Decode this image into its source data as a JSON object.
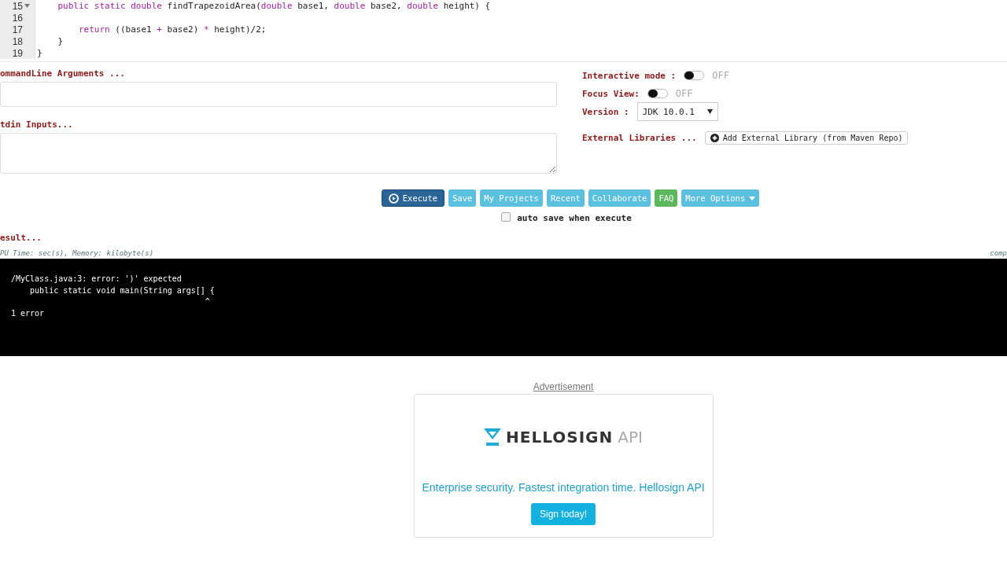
{
  "editor": {
    "lines": [
      {
        "number": "15",
        "folded": true,
        "tokens": [
          {
            "kind": "keyword",
            "text": "    public static double"
          },
          {
            "kind": "plain",
            "text": " findTrapezoidArea("
          },
          {
            "kind": "keyword",
            "text": "double"
          },
          {
            "kind": "plain",
            "text": " base1, "
          },
          {
            "kind": "keyword",
            "text": "double"
          },
          {
            "kind": "plain",
            "text": " base2, "
          },
          {
            "kind": "keyword",
            "text": "double"
          },
          {
            "kind": "plain",
            "text": " height) {"
          }
        ]
      },
      {
        "number": "16",
        "folded": false
      },
      {
        "number": "17",
        "folded": false,
        "tokens": [
          {
            "kind": "keyword",
            "text": "        return"
          },
          {
            "kind": "plain",
            "text": " (("
          },
          {
            "kind": "plain",
            "text": "base1 "
          },
          {
            "kind": "operator",
            "text": "+"
          },
          {
            "kind": "plain",
            "text": " base2) "
          },
          {
            "kind": "operator",
            "text": "*"
          },
          {
            "kind": "plain",
            "text": " height)/"
          },
          {
            "kind": "number",
            "text": "2"
          },
          {
            "kind": "plain",
            "text": ";"
          }
        ]
      },
      {
        "number": "18",
        "folded": false,
        "tokens": [
          {
            "kind": "plain",
            "text": "    }"
          }
        ]
      },
      {
        "number": "19",
        "folded": false,
        "tokens": [
          {
            "kind": "plain",
            "text": "}"
          }
        ]
      }
    ]
  },
  "args": {
    "label": "ommandLine Arguments ..."
  },
  "stdin": {
    "label": "tdin Inputs..."
  },
  "options": {
    "interactive": {
      "label": "Interactive mode :",
      "on": false,
      "state": "OFF"
    },
    "focus": {
      "label": "Focus View:",
      "on": false,
      "state": "OFF"
    },
    "version": {
      "label": "Version :",
      "value": "JDK 10.0.1"
    },
    "libraries": {
      "label": "External Libraries ...",
      "button": "Add External Library (from Maven Repo)"
    }
  },
  "actions": [
    {
      "label": "Execute",
      "kind": "primary"
    },
    {
      "label": "Save",
      "kind": "info"
    },
    {
      "label": "My Projects",
      "kind": "info"
    },
    {
      "label": "Recent",
      "kind": "info"
    },
    {
      "label": "Collaborate",
      "kind": "info"
    },
    {
      "label": "FAQ",
      "kind": "success"
    },
    {
      "label": "More Options",
      "kind": "dropdown"
    }
  ],
  "autosave": {
    "label": "auto save when execute",
    "checked": false
  },
  "result": {
    "label": "esult...",
    "stats": "PU Time: sec(s), Memory: kilobyte(s)",
    "side_note": "comp",
    "output": [
      "/MyClass.java:3: error: ')' expected",
      "    public static void main(String args[] {",
      "                                         ^",
      "1 error"
    ]
  },
  "ad": {
    "caption": "Advertisement",
    "brand": "HELLOSIGN",
    "brand_suffix": "API",
    "tagline": "Enterprise security. Fastest integration time. Hellosign API",
    "button": "Sign today!"
  }
}
